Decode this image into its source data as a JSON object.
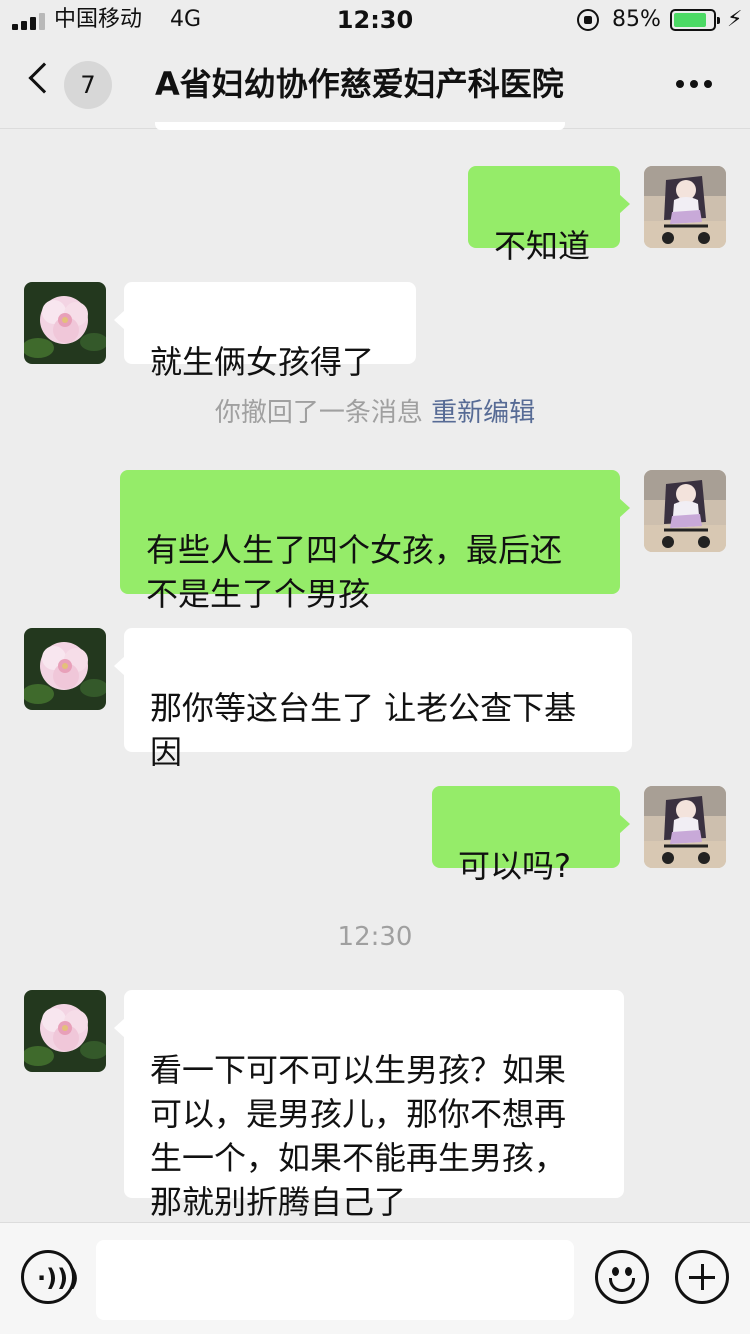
{
  "status_bar": {
    "carrier": "中国移动",
    "network": "4G",
    "time": "12:30",
    "battery_percent": "85%",
    "battery_level": 0.85,
    "battery_color": "#4cd964"
  },
  "nav": {
    "unread_count": "7",
    "title": "A省妇幼协作慈爱妇产科医院"
  },
  "colors": {
    "background": "#ededed",
    "incoming_bubble": "#ffffff",
    "outgoing_bubble": "#95ec69",
    "link": "#576b95",
    "system_text": "#a0a0a0"
  },
  "messages": [
    {
      "side": "outgoing",
      "text": "不知道"
    },
    {
      "side": "incoming",
      "text": "就生俩女孩得了"
    },
    {
      "side": "outgoing",
      "text": "有些人生了四个女孩，最后还\n不是生了个男孩"
    },
    {
      "side": "incoming",
      "text": "那你等这台生了 让老公查下基\n因"
    },
    {
      "side": "outgoing",
      "text": "可以吗?"
    },
    {
      "side": "incoming",
      "text": "看一下可不可以生男孩？如果\n可以，是男孩儿，那你不想再\n生一个，如果不能再生男孩，\n那就别折腾自己了"
    }
  ],
  "recall_notice": {
    "text": "你撤回了一条消息",
    "edit_link": "重新编辑"
  },
  "timestamp": "12:30",
  "input_bar": {
    "voice_icon": "voice-icon",
    "emoji_icon": "emoji-icon",
    "plus_icon": "plus-icon",
    "text_value": ""
  }
}
